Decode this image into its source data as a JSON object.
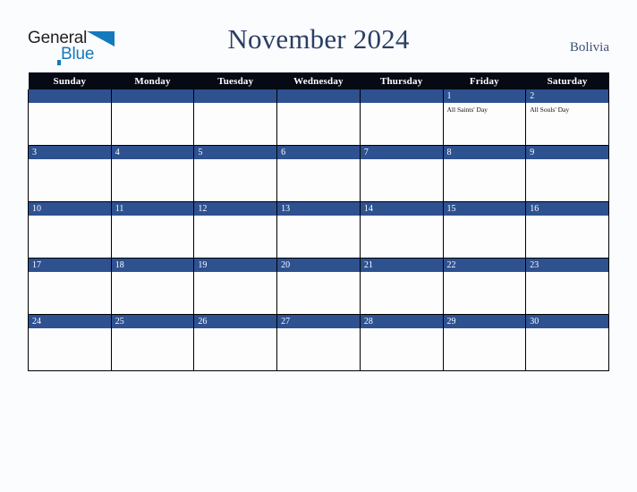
{
  "logo": {
    "word1": "General",
    "word2": "Blue",
    "triangle_icon": "blue-triangle-icon",
    "color_dark": "#231f20",
    "color_blue": "#1479bd"
  },
  "header": {
    "title": "November 2024",
    "country": "Bolivia",
    "title_color": "#2b3e63"
  },
  "theme": {
    "header_row_bg": "#050a14",
    "date_bar_bg": "#2e5190",
    "page_bg": "#fbfcfd",
    "cell_bg": "#fdfdfe",
    "grid_line": "#000000"
  },
  "calendar": {
    "weekdays": [
      "Sunday",
      "Monday",
      "Tuesday",
      "Wednesday",
      "Thursday",
      "Friday",
      "Saturday"
    ],
    "weeks": [
      [
        {
          "day": "",
          "events": []
        },
        {
          "day": "",
          "events": []
        },
        {
          "day": "",
          "events": []
        },
        {
          "day": "",
          "events": []
        },
        {
          "day": "",
          "events": []
        },
        {
          "day": "1",
          "events": [
            "All Saints' Day"
          ]
        },
        {
          "day": "2",
          "events": [
            "All Souls' Day"
          ]
        }
      ],
      [
        {
          "day": "3",
          "events": []
        },
        {
          "day": "4",
          "events": []
        },
        {
          "day": "5",
          "events": []
        },
        {
          "day": "6",
          "events": []
        },
        {
          "day": "7",
          "events": []
        },
        {
          "day": "8",
          "events": []
        },
        {
          "day": "9",
          "events": []
        }
      ],
      [
        {
          "day": "10",
          "events": []
        },
        {
          "day": "11",
          "events": []
        },
        {
          "day": "12",
          "events": []
        },
        {
          "day": "13",
          "events": []
        },
        {
          "day": "14",
          "events": []
        },
        {
          "day": "15",
          "events": []
        },
        {
          "day": "16",
          "events": []
        }
      ],
      [
        {
          "day": "17",
          "events": []
        },
        {
          "day": "18",
          "events": []
        },
        {
          "day": "19",
          "events": []
        },
        {
          "day": "20",
          "events": []
        },
        {
          "day": "21",
          "events": []
        },
        {
          "day": "22",
          "events": []
        },
        {
          "day": "23",
          "events": []
        }
      ],
      [
        {
          "day": "24",
          "events": []
        },
        {
          "day": "25",
          "events": []
        },
        {
          "day": "26",
          "events": []
        },
        {
          "day": "27",
          "events": []
        },
        {
          "day": "28",
          "events": []
        },
        {
          "day": "29",
          "events": []
        },
        {
          "day": "30",
          "events": []
        }
      ]
    ]
  }
}
